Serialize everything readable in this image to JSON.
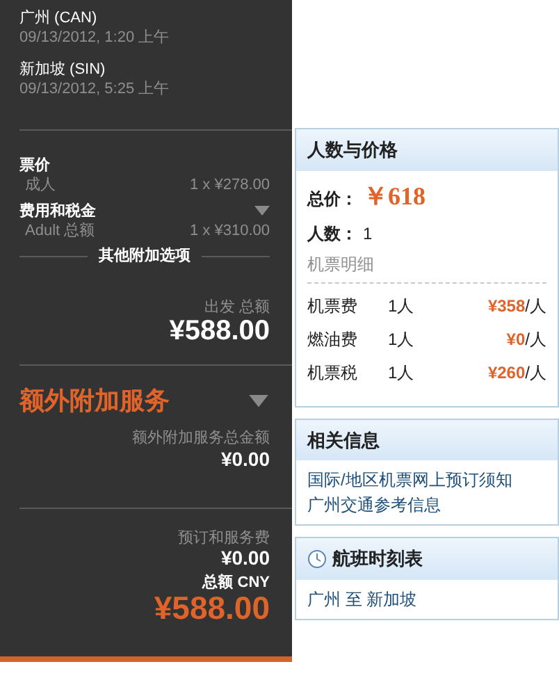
{
  "summary": {
    "flights": [
      {
        "place": "广州 (CAN)",
        "time": "09/13/2012, 1:20 上午"
      },
      {
        "place": "新加坡 (SIN)",
        "time": "09/13/2012, 5:25 上午"
      }
    ],
    "fare_groups": [
      {
        "title": "票价",
        "collapsible": false,
        "items": [
          {
            "label": "成人",
            "amount": "1 x ¥278.00"
          }
        ]
      },
      {
        "title": "费用和税金",
        "collapsible": true,
        "items": [
          {
            "label": "Adult 总额",
            "amount": "1 x ¥310.00"
          }
        ]
      }
    ],
    "options_heading": "其他附加选项",
    "departure_total": {
      "label": "出发 总额",
      "amount": "¥588.00"
    },
    "extras": {
      "title": "额外附加服务",
      "total_label": "额外附加服务总金额",
      "total": "¥0.00"
    },
    "booking_fee": {
      "label": "预订和服务费",
      "amount": "¥0.00"
    },
    "grand_total": {
      "label": "总额 CNY",
      "amount": "¥588.00"
    }
  },
  "price_card": {
    "title": "人数与价格",
    "total_label": "总价：",
    "total": "￥618",
    "people_label": "人数：",
    "people": "1",
    "detail_heading": "机票明细",
    "rows": [
      {
        "item": "机票费",
        "count": "1人",
        "price": "¥358",
        "unit": "/人"
      },
      {
        "item": "燃油费",
        "count": "1人",
        "price": "¥0",
        "unit": "/人"
      },
      {
        "item": "机票税",
        "count": "1人",
        "price": "¥260",
        "unit": "/人"
      }
    ]
  },
  "info_card": {
    "title": "相关信息",
    "links": [
      "国际/地区机票网上预订须知",
      "广州交通参考信息"
    ]
  },
  "schedule_card": {
    "title": "航班时刻表",
    "route": [
      "广州",
      "至",
      "新加坡"
    ]
  }
}
